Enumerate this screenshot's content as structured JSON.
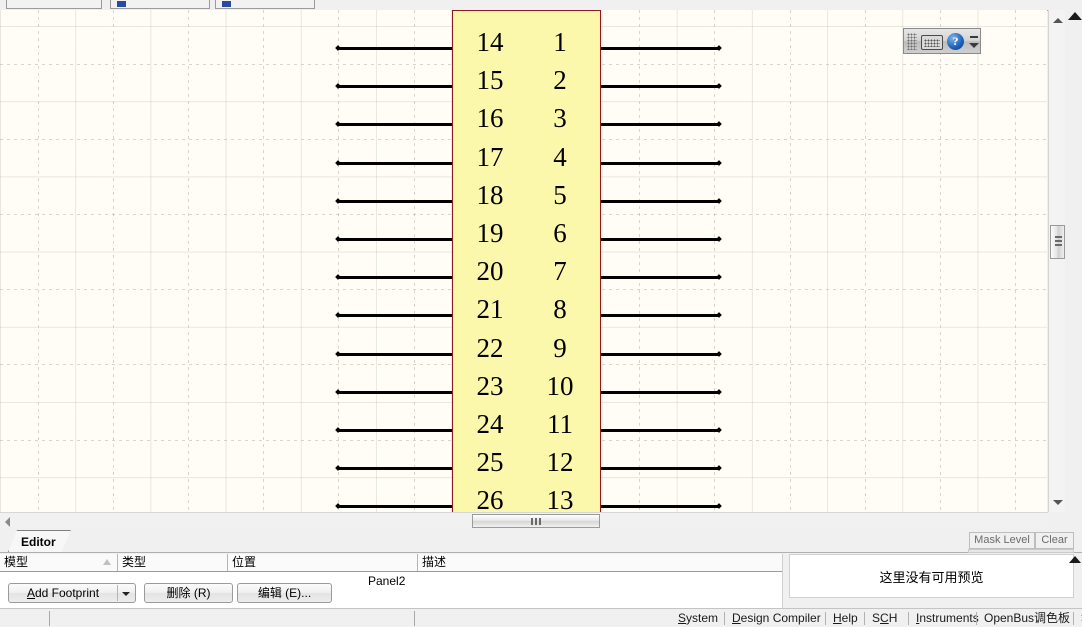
{
  "window": {
    "top_tabs": [
      {
        "name": "tab-1",
        "label": "",
        "has_icon": false
      },
      {
        "name": "tab-2",
        "label": "",
        "has_icon": true
      },
      {
        "name": "tab-3",
        "label": "",
        "has_icon": true
      }
    ]
  },
  "canvas": {
    "background_color": "#fffdf5",
    "symbol": {
      "fill_color": "#fbf8ab",
      "border_color": "#8b1a1a",
      "left_pins": [
        "14",
        "15",
        "16",
        "17",
        "18",
        "19",
        "20",
        "21",
        "22",
        "23",
        "24",
        "25",
        "26"
      ],
      "right_pins": [
        "1",
        "2",
        "3",
        "4",
        "5",
        "6",
        "7",
        "8",
        "9",
        "10",
        "11",
        "12",
        "13"
      ]
    },
    "float_toolbar": {
      "grip": "drag-grip",
      "keyboard_icon": "keyboard-icon",
      "help_icon": "?",
      "minimize": "minimize-icon",
      "expand": "chevron-down-icon"
    }
  },
  "editor_tab": {
    "label": "Editor"
  },
  "mask": {
    "mask_level_label": "Mask Level",
    "clear_label": "Clear"
  },
  "model_grid": {
    "columns": [
      {
        "label": "模型",
        "sorted": true
      },
      {
        "label": "类型",
        "sorted": false
      },
      {
        "label": "位置",
        "sorted": false
      },
      {
        "label": "描述",
        "sorted": false
      }
    ],
    "rows": [],
    "panel_label": "Panel2"
  },
  "buttons": {
    "add_footprint": {
      "label": "Add Footprint",
      "accel": "A",
      "has_dropdown": true
    },
    "delete": {
      "label": "删除 (R)"
    },
    "edit": {
      "label": "编辑 (E)..."
    }
  },
  "preview": {
    "empty_text": "这里没有可用预览"
  },
  "statusbar": {
    "items": [
      {
        "label": "System",
        "accel": "S"
      },
      {
        "label": "Design Compiler",
        "accel": "D"
      },
      {
        "label": "Help",
        "accel": "H"
      },
      {
        "label": "SCH",
        "accel": "C"
      },
      {
        "label": "Instruments",
        "accel": "I"
      },
      {
        "label": "OpenBus调色板",
        "accel": ""
      },
      {
        "label": ">>",
        "accel": ""
      }
    ]
  }
}
